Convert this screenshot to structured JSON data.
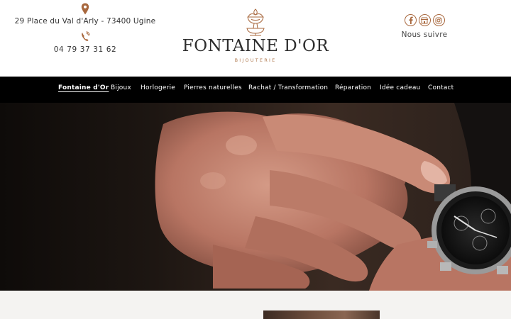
{
  "header": {
    "address": "29 Place du Val d'Arly - 73400 Ugine",
    "phone": "04 79 37 31 62",
    "brand": "FONTAINE D'OR",
    "subbrand": "BIJOUTERIE",
    "follow_label": "Nous suivre",
    "social_icons": [
      "facebook-icon",
      "shop-icon",
      "instagram-icon"
    ]
  },
  "nav": {
    "items": [
      "Fontaine d'Or",
      "Bijoux",
      "Horlogerie",
      "Pierres naturelles",
      "Rachat / Transformation",
      "Réparation",
      "Idée cadeau",
      "Contact"
    ],
    "active": "Fontaine d'Or"
  },
  "colors": {
    "accent": "#a8683e",
    "nav_bg": "#000000",
    "text": "#333333"
  }
}
